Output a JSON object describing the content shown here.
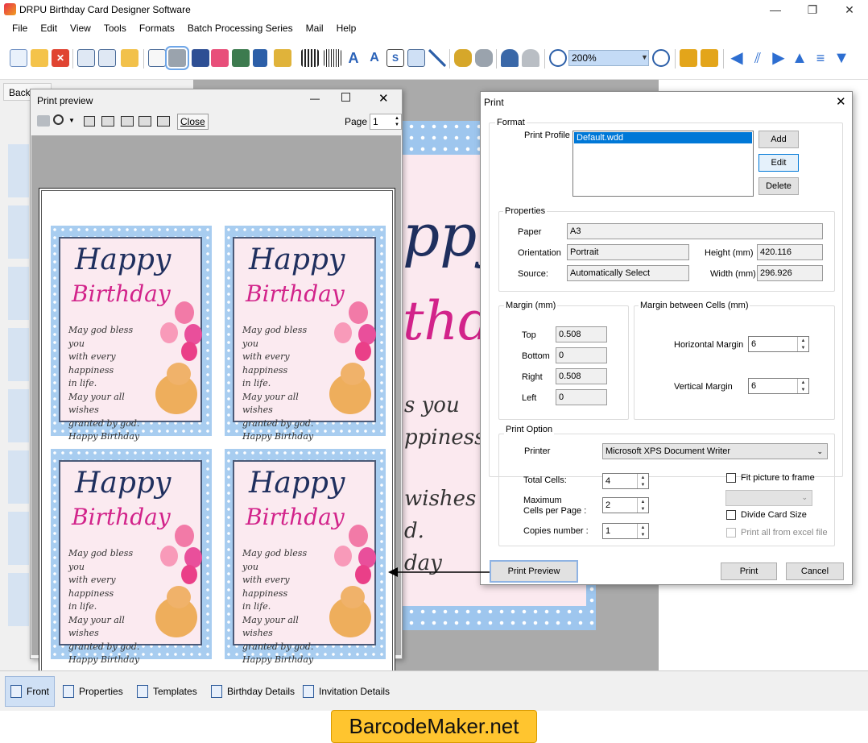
{
  "app": {
    "title": "DRPU Birthday Card Designer Software",
    "window_controls": [
      "—",
      "❐",
      "✕"
    ]
  },
  "menu": [
    "File",
    "Edit",
    "View",
    "Tools",
    "Formats",
    "Batch Processing Series",
    "Mail",
    "Help"
  ],
  "toolbar": {
    "zoom_value": "200%",
    "icons": [
      "new-icon",
      "open-icon",
      "close-icon",
      "save-icon",
      "save-as-icon",
      "export-icon",
      "page-setup-icon",
      "print-icon",
      "copy-icon",
      "gift-icon",
      "image-icon",
      "pen-icon",
      "shapes-icon",
      "barcode-icon",
      "text-icon",
      "wordart-icon",
      "signature-icon",
      "mail-icon",
      "line-icon",
      "database-icon",
      "database2-icon",
      "undo-icon",
      "redo-icon",
      "zoom-in-icon",
      "zoom-out-icon",
      "lock-icon",
      "unlock-icon",
      "arrow-left-icon",
      "flip-icon",
      "arrow-right-icon",
      "arrow-up-icon",
      "align-icon",
      "arrow-down-icon"
    ]
  },
  "workspace": {
    "back_tab": "Back",
    "canvas_lines": [
      "ppy",
      "thda",
      "s you",
      "ppiness",
      "wishes",
      "d.",
      "day"
    ]
  },
  "preview_window": {
    "title": "Print preview",
    "close_label": "Close",
    "page_label": "Page",
    "page_value": "1",
    "card": {
      "happy": "Happy",
      "birthday": "Birthday",
      "message_lines": [
        "May god bless you",
        "with every happiness",
        "in life.",
        "May your all wishes",
        "granted by god.",
        "Happy Birthday"
      ]
    }
  },
  "print_dialog": {
    "title": "Print",
    "format": {
      "group_label": "Format",
      "profile_label": "Print Profile",
      "profile_selected": "Default.wdd",
      "add": "Add",
      "edit": "Edit",
      "delete": "Delete"
    },
    "properties": {
      "group_label": "Properties",
      "paper_label": "Paper",
      "paper_value": "A3",
      "orientation_label": "Orientation",
      "orientation_value": "Portrait",
      "source_label": "Source:",
      "source_value": "Automatically Select",
      "height_label": "Height (mm)",
      "height_value": "420.116",
      "width_label": "Width (mm)",
      "width_value": "296.926"
    },
    "margin": {
      "group_label": "Margin (mm)",
      "top_label": "Top",
      "top_value": "0.508",
      "bottom_label": "Bottom",
      "bottom_value": "0",
      "right_label": "Right",
      "right_value": "0.508",
      "left_label": "Left",
      "left_value": "0"
    },
    "cell_margin": {
      "group_label": "Margin between Cells (mm)",
      "horizontal_label": "Horizontal Margin",
      "horizontal_value": "6",
      "vertical_label": "Vertical Margin",
      "vertical_value": "6"
    },
    "print_option": {
      "group_label": "Print Option",
      "printer_label": "Printer",
      "printer_value": "Microsoft XPS Document Writer",
      "total_cells_label": "Total Cells:",
      "total_cells_value": "4",
      "max_cells_label_1": "Maximum",
      "max_cells_label_2": "Cells per Page :",
      "max_cells_value": "2",
      "copies_label": "Copies number :",
      "copies_value": "1",
      "fit_picture": "Fit picture to frame",
      "divide_card": "Divide Card Size",
      "print_all_excel": "Print all from excel file"
    },
    "buttons": {
      "preview": "Print Preview",
      "print": "Print",
      "cancel": "Cancel"
    }
  },
  "bottom_tabs": [
    "Front",
    "Properties",
    "Templates",
    "Birthday Details",
    "Invitation Details"
  ],
  "watermark": "BarcodeMaker.net"
}
